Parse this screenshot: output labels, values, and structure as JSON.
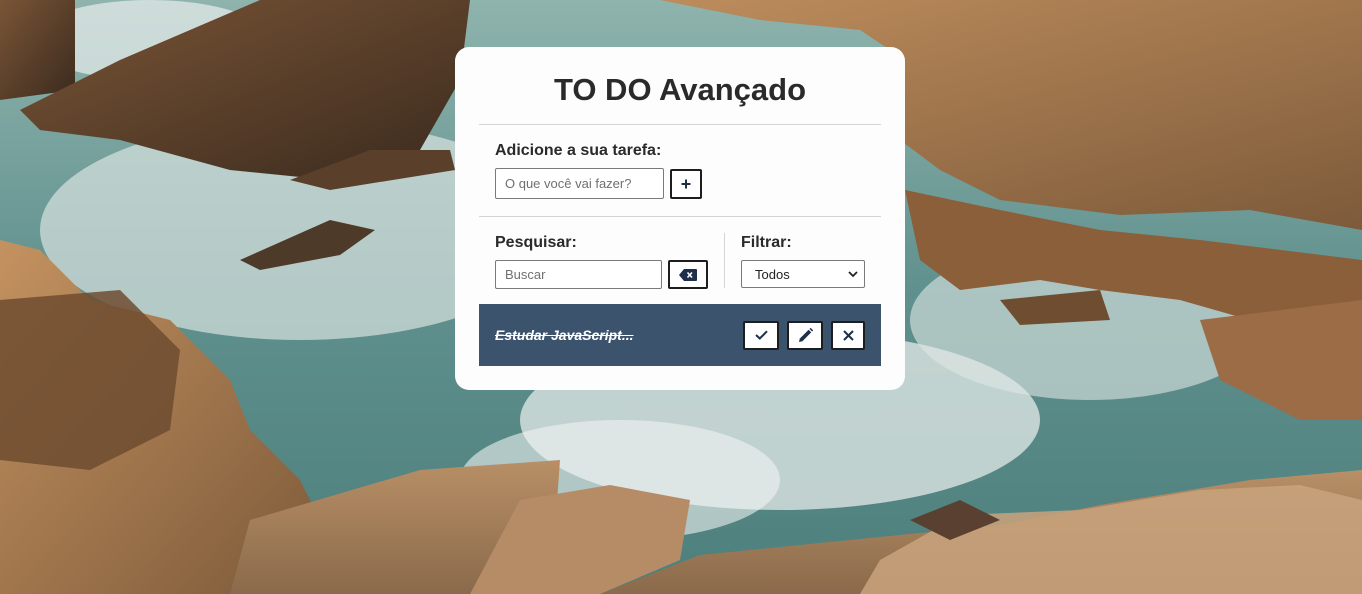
{
  "app": {
    "title": "TO DO Avançado"
  },
  "add_form": {
    "label": "Adicione a sua tarefa:",
    "input_placeholder": "O que você vai fazer?",
    "input_value": "",
    "add_icon": "plus-icon"
  },
  "search": {
    "label": "Pesquisar:",
    "placeholder": "Buscar",
    "value": "",
    "clear_icon": "backspace-icon"
  },
  "filter": {
    "label": "Filtrar:",
    "selected": "Todos",
    "icon": "chevron-down-icon"
  },
  "todos": [
    {
      "text": "Estudar JavaScript...",
      "done": true,
      "actions": [
        "check-icon",
        "pencil-icon",
        "close-icon"
      ]
    }
  ],
  "colors": {
    "card_background": "#fdfdfd",
    "todo_background": "#3c536d",
    "title_text": "#2a2a2a",
    "accent_dark": "#1d1d1d"
  }
}
